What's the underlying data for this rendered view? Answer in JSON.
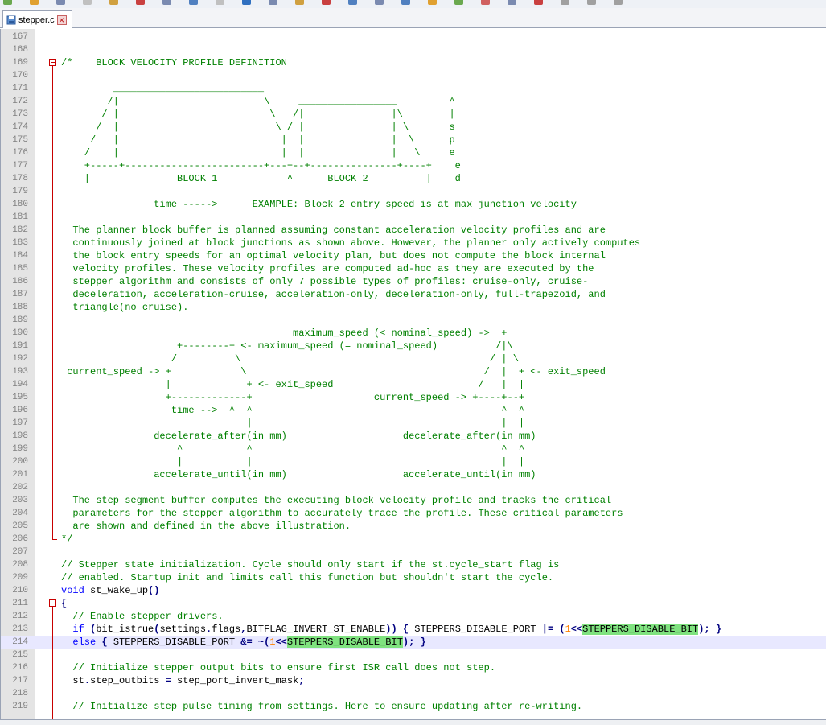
{
  "tab": {
    "filename": "stepper.c",
    "icon": "file-icon",
    "close_icon": "close-icon"
  },
  "colors": {
    "comment": "#008000",
    "keyword": "#0000ff",
    "operator": "#000080",
    "number": "#ff8000",
    "highlight": "#7fe27f",
    "current_line": "#e8e8ff",
    "fold_marker": "#c80000"
  },
  "current_line_number": "214",
  "lines": [
    {
      "n": "167",
      "t": []
    },
    {
      "n": "168",
      "t": []
    },
    {
      "n": "169",
      "t": [
        {
          "s": "/*    BLOCK VELOCITY PROFILE DEFINITION",
          "c": "cm"
        }
      ]
    },
    {
      "n": "170",
      "t": []
    },
    {
      "n": "171",
      "t": [
        {
          "s": "         __________________________",
          "c": "cm"
        }
      ]
    },
    {
      "n": "172",
      "t": [
        {
          "s": "        /|                        |\\     _________________         ^",
          "c": "cm"
        }
      ]
    },
    {
      "n": "173",
      "t": [
        {
          "s": "       / |                        | \\   /|               |\\        |",
          "c": "cm"
        }
      ]
    },
    {
      "n": "174",
      "t": [
        {
          "s": "      /  |                        |  \\ / |               | \\       s",
          "c": "cm"
        }
      ]
    },
    {
      "n": "175",
      "t": [
        {
          "s": "     /   |                        |   |  |               |  \\      p",
          "c": "cm"
        }
      ]
    },
    {
      "n": "176",
      "t": [
        {
          "s": "    /    |                        |   |  |               |   \\     e",
          "c": "cm"
        }
      ]
    },
    {
      "n": "177",
      "t": [
        {
          "s": "    +-----+------------------------+---+--+---------------+----+    e",
          "c": "cm"
        }
      ]
    },
    {
      "n": "178",
      "t": [
        {
          "s": "    |               BLOCK 1            ^      BLOCK 2          |    d",
          "c": "cm"
        }
      ]
    },
    {
      "n": "179",
      "t": [
        {
          "s": "                                       |",
          "c": "cm"
        }
      ]
    },
    {
      "n": "180",
      "t": [
        {
          "s": "                time ----->      EXAMPLE: Block 2 entry speed is at max junction velocity",
          "c": "cm"
        }
      ]
    },
    {
      "n": "181",
      "t": []
    },
    {
      "n": "182",
      "t": [
        {
          "s": "  The planner block buffer is planned assuming constant acceleration velocity profiles and are",
          "c": "cm"
        }
      ]
    },
    {
      "n": "183",
      "t": [
        {
          "s": "  continuously joined at block junctions as shown above. However, the planner only actively computes",
          "c": "cm"
        }
      ]
    },
    {
      "n": "184",
      "t": [
        {
          "s": "  the block entry speeds for an optimal velocity plan, but does not compute the block internal",
          "c": "cm"
        }
      ]
    },
    {
      "n": "185",
      "t": [
        {
          "s": "  velocity profiles. These velocity profiles are computed ad-hoc as they are executed by the",
          "c": "cm"
        }
      ]
    },
    {
      "n": "186",
      "t": [
        {
          "s": "  stepper algorithm and consists of only 7 possible types of profiles: cruise-only, cruise-",
          "c": "cm"
        }
      ]
    },
    {
      "n": "187",
      "t": [
        {
          "s": "  deceleration, acceleration-cruise, acceleration-only, deceleration-only, full-trapezoid, and",
          "c": "cm"
        }
      ]
    },
    {
      "n": "188",
      "t": [
        {
          "s": "  triangle(no cruise).",
          "c": "cm"
        }
      ]
    },
    {
      "n": "189",
      "t": []
    },
    {
      "n": "190",
      "t": [
        {
          "s": "                                        maximum_speed (< nominal_speed) ->  +",
          "c": "cm"
        }
      ]
    },
    {
      "n": "191",
      "t": [
        {
          "s": "                    +--------+ <- maximum_speed (= nominal_speed)          /|\\",
          "c": "cm"
        }
      ]
    },
    {
      "n": "192",
      "t": [
        {
          "s": "                   /          \\                                           / | \\",
          "c": "cm"
        }
      ]
    },
    {
      "n": "193",
      "t": [
        {
          "s": " current_speed -> +            \\                                         /  |  + <- exit_speed",
          "c": "cm"
        }
      ]
    },
    {
      "n": "194",
      "t": [
        {
          "s": "                  |             + <- exit_speed                         /   |  |",
          "c": "cm"
        }
      ]
    },
    {
      "n": "195",
      "t": [
        {
          "s": "                  +-------------+                     current_speed -> +----+--+",
          "c": "cm"
        }
      ]
    },
    {
      "n": "196",
      "t": [
        {
          "s": "                   time -->  ^  ^                                           ^  ^",
          "c": "cm"
        }
      ]
    },
    {
      "n": "197",
      "t": [
        {
          "s": "                             |  |                                           |  |",
          "c": "cm"
        }
      ]
    },
    {
      "n": "198",
      "t": [
        {
          "s": "                decelerate_after(in mm)                    decelerate_after(in mm)",
          "c": "cm"
        }
      ]
    },
    {
      "n": "199",
      "t": [
        {
          "s": "                    ^           ^                                           ^  ^",
          "c": "cm"
        }
      ]
    },
    {
      "n": "200",
      "t": [
        {
          "s": "                    |           |                                           |  |",
          "c": "cm"
        }
      ]
    },
    {
      "n": "201",
      "t": [
        {
          "s": "                accelerate_until(in mm)                    accelerate_until(in mm)",
          "c": "cm"
        }
      ]
    },
    {
      "n": "202",
      "t": []
    },
    {
      "n": "203",
      "t": [
        {
          "s": "  The step segment buffer computes the executing block velocity profile and tracks the critical",
          "c": "cm"
        }
      ]
    },
    {
      "n": "204",
      "t": [
        {
          "s": "  parameters for the stepper algorithm to accurately trace the profile. These critical parameters",
          "c": "cm"
        }
      ]
    },
    {
      "n": "205",
      "t": [
        {
          "s": "  are shown and defined in the above illustration.",
          "c": "cm"
        }
      ]
    },
    {
      "n": "206",
      "t": [
        {
          "s": "*/",
          "c": "cm"
        }
      ]
    },
    {
      "n": "207",
      "t": []
    },
    {
      "n": "208",
      "t": [
        {
          "s": "// Stepper state initialization. Cycle should only start if the st.cycle_start flag is",
          "c": "cm"
        }
      ]
    },
    {
      "n": "209",
      "t": [
        {
          "s": "// enabled. Startup init and limits call this function but shouldn't start the cycle.",
          "c": "cm"
        }
      ]
    },
    {
      "n": "210",
      "t": [
        {
          "s": "void",
          "c": "kw"
        },
        {
          "s": " st_wake_up",
          "c": ""
        },
        {
          "s": "()",
          "c": "op"
        }
      ]
    },
    {
      "n": "211",
      "t": [
        {
          "s": "{",
          "c": "op"
        }
      ]
    },
    {
      "n": "212",
      "t": [
        {
          "s": "  // Enable stepper drivers.",
          "c": "cm"
        }
      ]
    },
    {
      "n": "213",
      "t": [
        {
          "s": "  ",
          "c": ""
        },
        {
          "s": "if",
          "c": "kw"
        },
        {
          "s": " ",
          "c": ""
        },
        {
          "s": "(",
          "c": "op"
        },
        {
          "s": "bit_istrue",
          "c": ""
        },
        {
          "s": "(",
          "c": "op"
        },
        {
          "s": "settings",
          "c": ""
        },
        {
          "s": ".",
          "c": "op"
        },
        {
          "s": "flags",
          "c": ""
        },
        {
          "s": ",",
          "c": "op"
        },
        {
          "s": "BITFLAG_INVERT_ST_ENABLE",
          "c": ""
        },
        {
          "s": "))",
          "c": "op"
        },
        {
          "s": " ",
          "c": ""
        },
        {
          "s": "{",
          "c": "op"
        },
        {
          "s": " STEPPERS_DISABLE_PORT ",
          "c": ""
        },
        {
          "s": "|=",
          "c": "op"
        },
        {
          "s": " ",
          "c": ""
        },
        {
          "s": "(",
          "c": "op"
        },
        {
          "s": "1",
          "c": "num"
        },
        {
          "s": "<<",
          "c": "op"
        },
        {
          "s": "STEPPERS_DISABLE_BIT",
          "c": "hl"
        },
        {
          "s": ");",
          "c": "op"
        },
        {
          "s": " ",
          "c": ""
        },
        {
          "s": "}",
          "c": "op"
        }
      ]
    },
    {
      "n": "214",
      "t": [
        {
          "s": "  ",
          "c": ""
        },
        {
          "s": "else",
          "c": "kw"
        },
        {
          "s": " ",
          "c": ""
        },
        {
          "s": "{",
          "c": "op"
        },
        {
          "s": " STEPPERS_DISABLE_PORT ",
          "c": ""
        },
        {
          "s": "&=",
          "c": "op"
        },
        {
          "s": " ",
          "c": ""
        },
        {
          "s": "~(",
          "c": "op"
        },
        {
          "s": "1",
          "c": "num"
        },
        {
          "s": "<<",
          "c": "op"
        },
        {
          "s": "STEPPERS_DISABLE_BIT",
          "c": "hl"
        },
        {
          "s": ");",
          "c": "op"
        },
        {
          "s": " ",
          "c": ""
        },
        {
          "s": "}",
          "c": "op"
        }
      ]
    },
    {
      "n": "215",
      "t": []
    },
    {
      "n": "216",
      "t": [
        {
          "s": "  // Initialize stepper output bits to ensure first ISR call does not step.",
          "c": "cm"
        }
      ]
    },
    {
      "n": "217",
      "t": [
        {
          "s": "  st",
          "c": ""
        },
        {
          "s": ".",
          "c": "op"
        },
        {
          "s": "step_outbits ",
          "c": ""
        },
        {
          "s": "=",
          "c": "op"
        },
        {
          "s": " step_port_invert_mask",
          "c": ""
        },
        {
          "s": ";",
          "c": "op"
        }
      ]
    },
    {
      "n": "218",
      "t": []
    },
    {
      "n": "219",
      "t": [
        {
          "s": "  // Initialize step pulse timing from settings. Here to ensure updating after re-writing.",
          "c": "cm"
        }
      ]
    }
  ]
}
